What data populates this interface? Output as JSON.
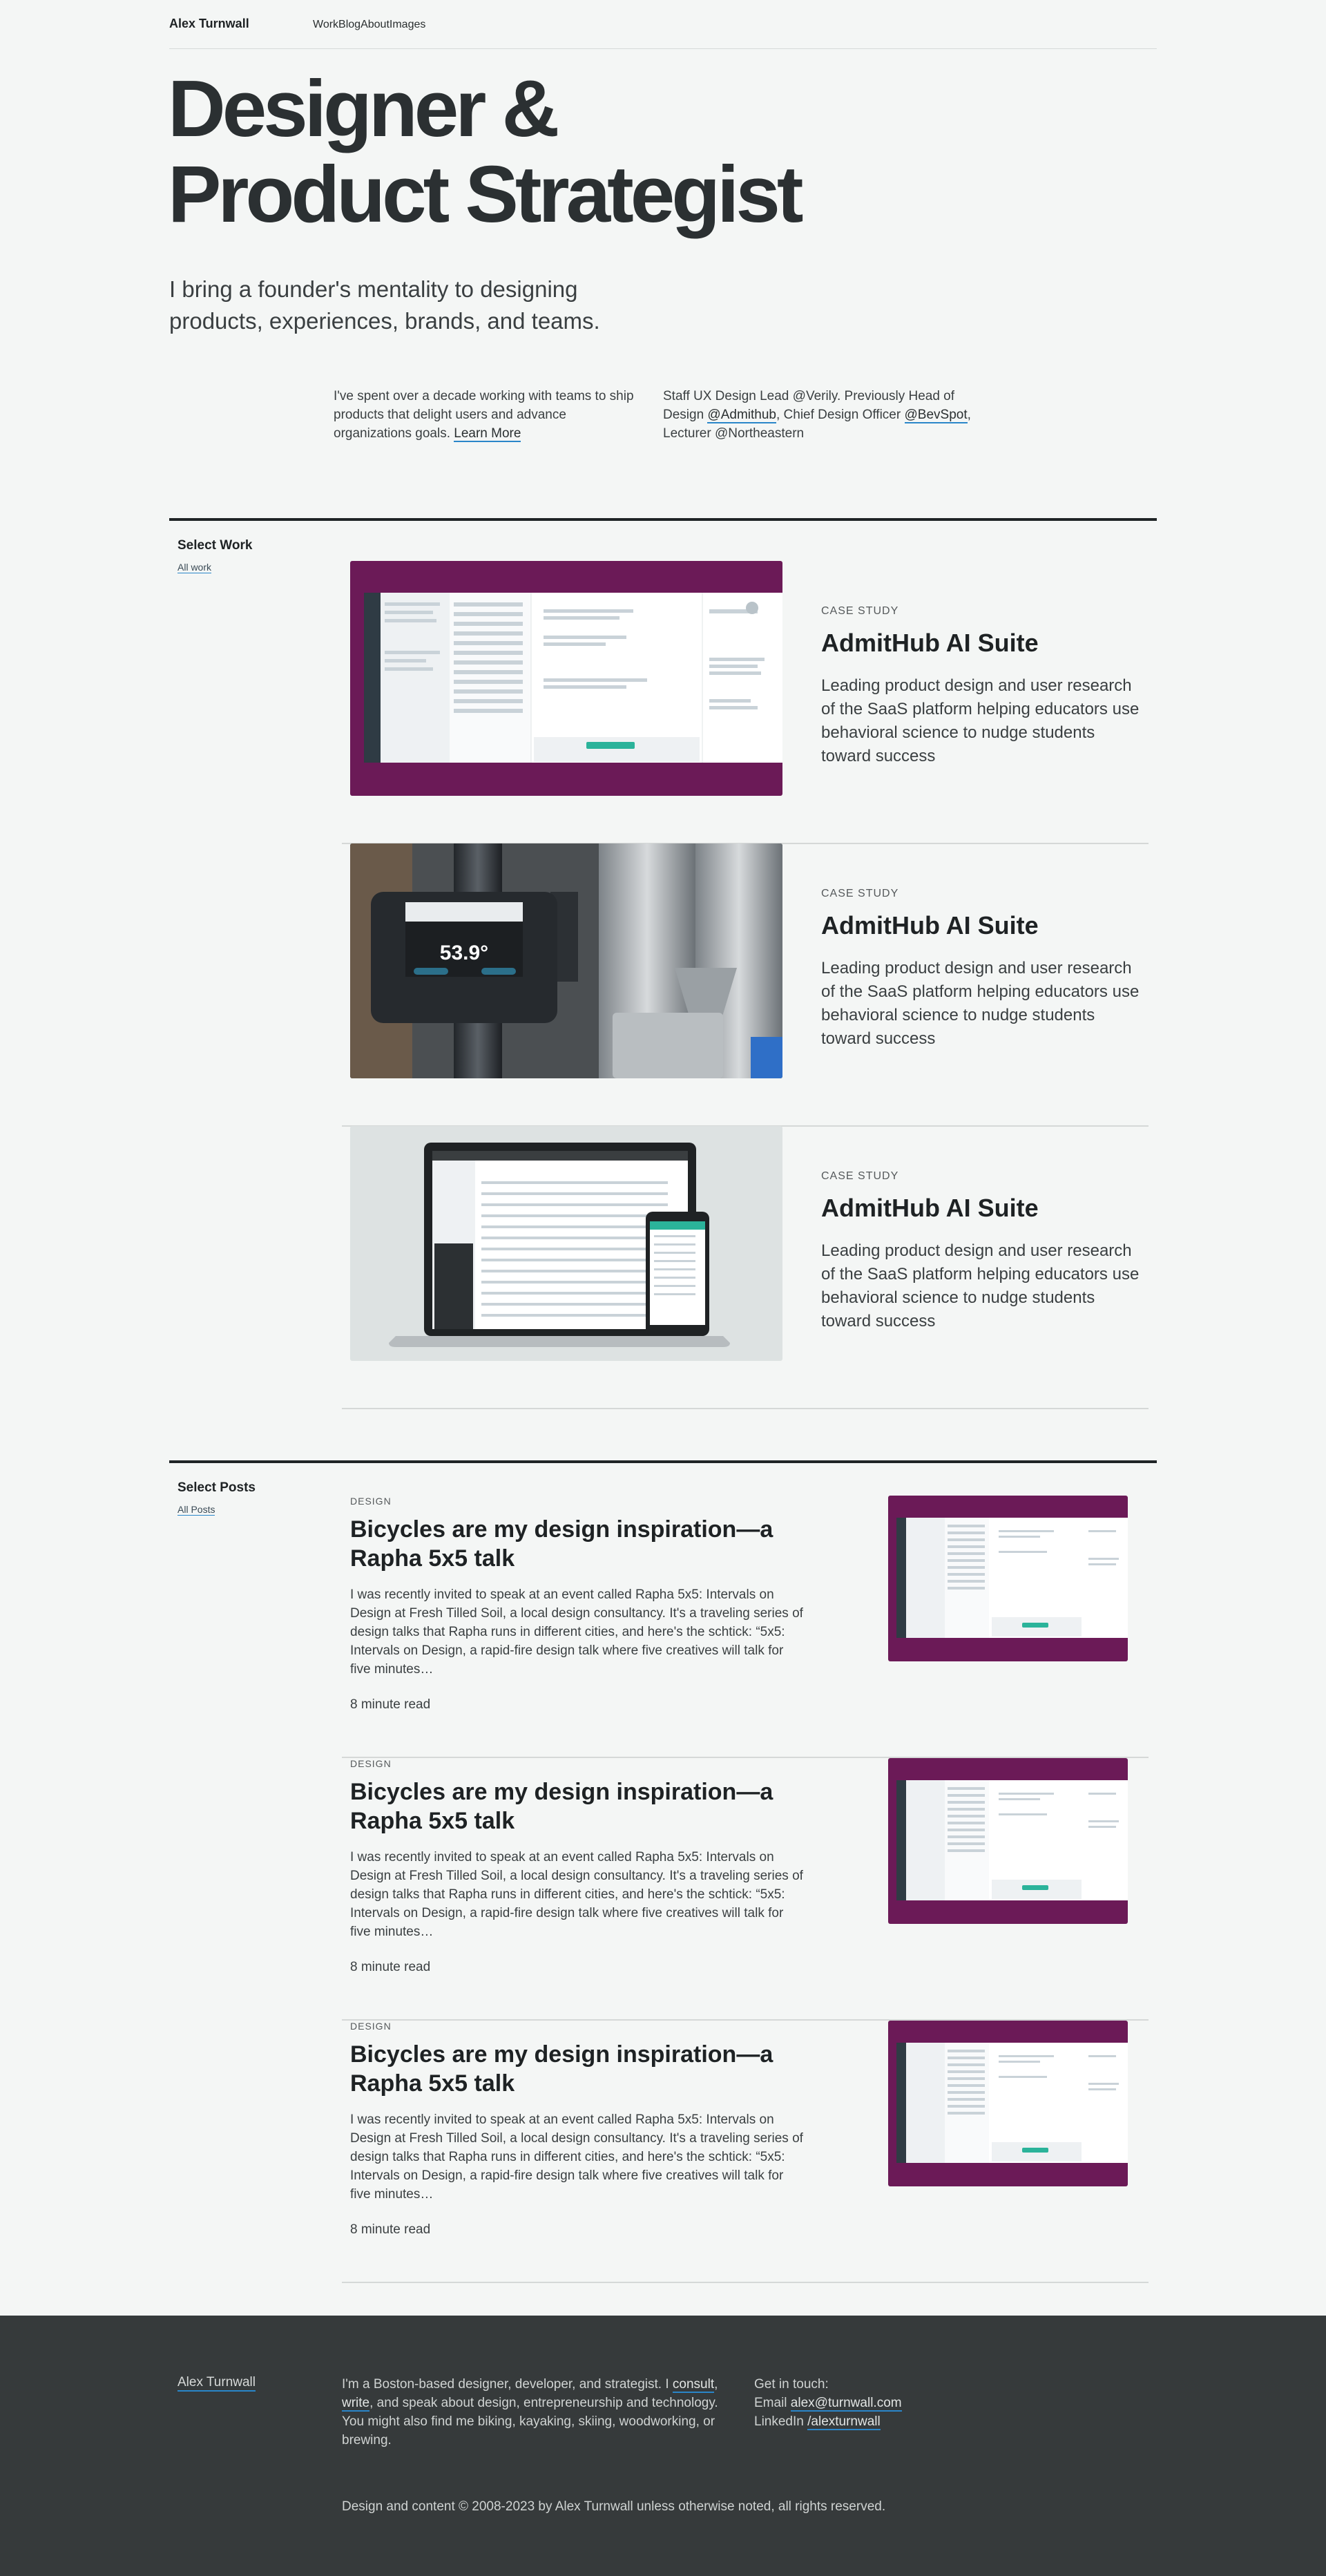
{
  "header": {
    "brand": "Alex Turnwall",
    "nav": [
      "Work",
      "Blog",
      "About",
      "Images"
    ]
  },
  "hero": {
    "title_line1": "Designer &",
    "title_line2": "Product Strategist",
    "subtitle": "I bring a founder's mentality to designing products, experiences, brands, and teams."
  },
  "intro": {
    "left_text": "I've spent over a decade working with teams to ship products that delight users and advance organizations goals.",
    "left_link": "Learn More",
    "right_part1": "Staff UX Design Lead @Verily. Previously Head of Design ",
    "right_link1": "@Admithub",
    "right_part2": ", Chief Design Officer ",
    "right_link2": "@BevSpot",
    "right_part3": ", Lecturer @Northeastern"
  },
  "work": {
    "label": "Select Work",
    "link": "All work",
    "items": [
      {
        "kicker": "CASE STUDY",
        "title": "AdmitHub AI Suite",
        "desc": "Leading product design and user research of the SaaS platform helping educators use behavioral science to nudge students toward success"
      },
      {
        "kicker": "CASE STUDY",
        "title": "AdmitHub AI Suite",
        "desc": "Leading product design and user research of the SaaS platform helping educators use behavioral science to nudge students toward success"
      },
      {
        "kicker": "CASE STUDY",
        "title": "AdmitHub AI Suite",
        "desc": "Leading product design and user research of the SaaS platform helping educators use behavioral science to nudge students toward success"
      }
    ],
    "device_reading": "53.9°"
  },
  "posts": {
    "label": "Select Posts",
    "link": "All Posts",
    "items": [
      {
        "kicker": "DESIGN",
        "title": "Bicycles are my design inspiration—a Rapha 5x5 talk",
        "excerpt": "I was recently invited to speak at an event called Rapha 5x5: Intervals on Design at Fresh Tilled Soil, a local design consultancy. It's a traveling series of design talks that Rapha runs in different cities, and here's the schtick: “5x5: Intervals on Design, a rapid-fire design talk where five creatives will talk for five minutes…",
        "read": "8 minute read"
      },
      {
        "kicker": "DESIGN",
        "title": "Bicycles are my design inspiration—a Rapha 5x5 talk",
        "excerpt": "I was recently invited to speak at an event called Rapha 5x5: Intervals on Design at Fresh Tilled Soil, a local design consultancy. It's a traveling series of design talks that Rapha runs in different cities, and here's the schtick: “5x5: Intervals on Design, a rapid-fire design talk where five creatives will talk for five minutes…",
        "read": "8 minute read"
      },
      {
        "kicker": "DESIGN",
        "title": "Bicycles are my design inspiration—a Rapha 5x5 talk",
        "excerpt": "I was recently invited to speak at an event called Rapha 5x5: Intervals on Design at Fresh Tilled Soil, a local design consultancy. It's a traveling series of design talks that Rapha runs in different cities, and here's the schtick: “5x5: Intervals on Design, a rapid-fire design talk where five creatives will talk for five minutes…",
        "read": "8 minute read"
      }
    ]
  },
  "footer": {
    "name": "Alex Turnwall",
    "bio_part1": "I'm a Boston-based designer, developer, and strategist. I ",
    "bio_link1": "consult",
    "bio_part2": ", ",
    "bio_link2": "write",
    "bio_part3": ", and speak about design, entrepreneurship and technology. You might also find me biking, kayaking, skiing, woodworking, or brewing.",
    "contact_heading": "Get in touch:",
    "email_label": "Email ",
    "email": "alex@turnwall.com",
    "linkedin_label": "LinkedIn ",
    "linkedin": "/alexturnwall",
    "copyright": "Design and content © 2008-2023 by Alex Turnwall unless otherwise noted, all rights reserved."
  },
  "colors": {
    "background": "#f4f6f5",
    "text": "#2a2f30",
    "link_underline": "#2a86c9",
    "thumb_purple": "#6b1a57",
    "footer_bg": "#363a3b",
    "teal_button": "#2bb39a"
  }
}
